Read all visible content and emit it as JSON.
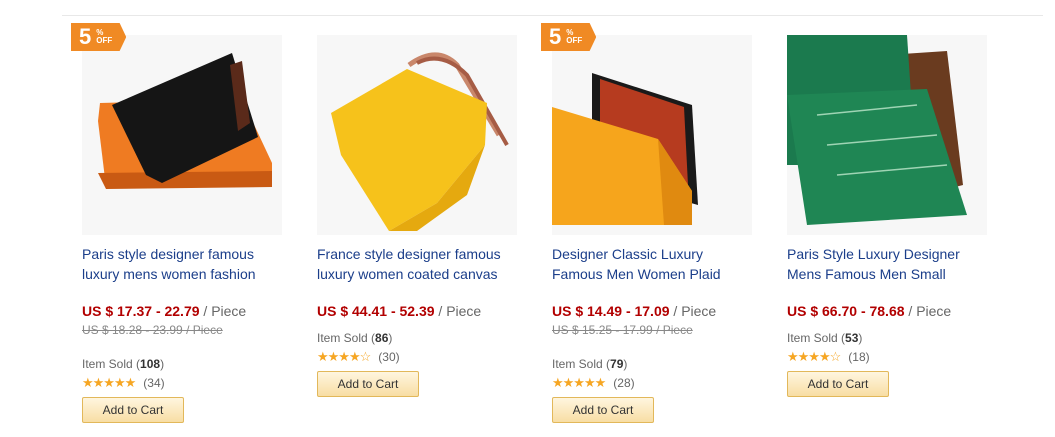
{
  "products": [
    {
      "badge_num": "5",
      "badge_pct": "%",
      "badge_off": "OFF",
      "title": "Paris style designer famous luxury mens women fashion",
      "price": "US $ 17.37 - 22.79",
      "unit": "/ Piece",
      "original_price": "US $ 18.28 - 23.99 / Piece",
      "sold_label": "Item Sold",
      "sold_count": "108",
      "stars": "★★★★★",
      "reviews": "(34)",
      "cart_label": "Add to Cart"
    },
    {
      "title": "France style designer famous luxury women coated canvas",
      "price": "US $ 44.41 - 52.39",
      "unit": "/ Piece",
      "sold_label": "Item Sold",
      "sold_count": "86",
      "stars": "★★★★☆",
      "reviews": "(30)",
      "cart_label": "Add to Cart"
    },
    {
      "badge_num": "5",
      "badge_pct": "%",
      "badge_off": "OFF",
      "title": "Designer Classic Luxury Famous Men Women Plaid",
      "price": "US $ 14.49 - 17.09",
      "unit": "/ Piece",
      "original_price": "US $ 15.25 - 17.99 / Piece",
      "sold_label": "Item Sold",
      "sold_count": "79",
      "stars": "★★★★★",
      "reviews": "(28)",
      "cart_label": "Add to Cart"
    },
    {
      "title": "Paris Style Luxury Designer Mens Famous Men Small",
      "price": "US $ 66.70 - 78.68",
      "unit": "/ Piece",
      "sold_label": "Item Sold",
      "sold_count": "53",
      "stars": "★★★★☆",
      "reviews": "(18)",
      "cart_label": "Add to Cart"
    }
  ]
}
